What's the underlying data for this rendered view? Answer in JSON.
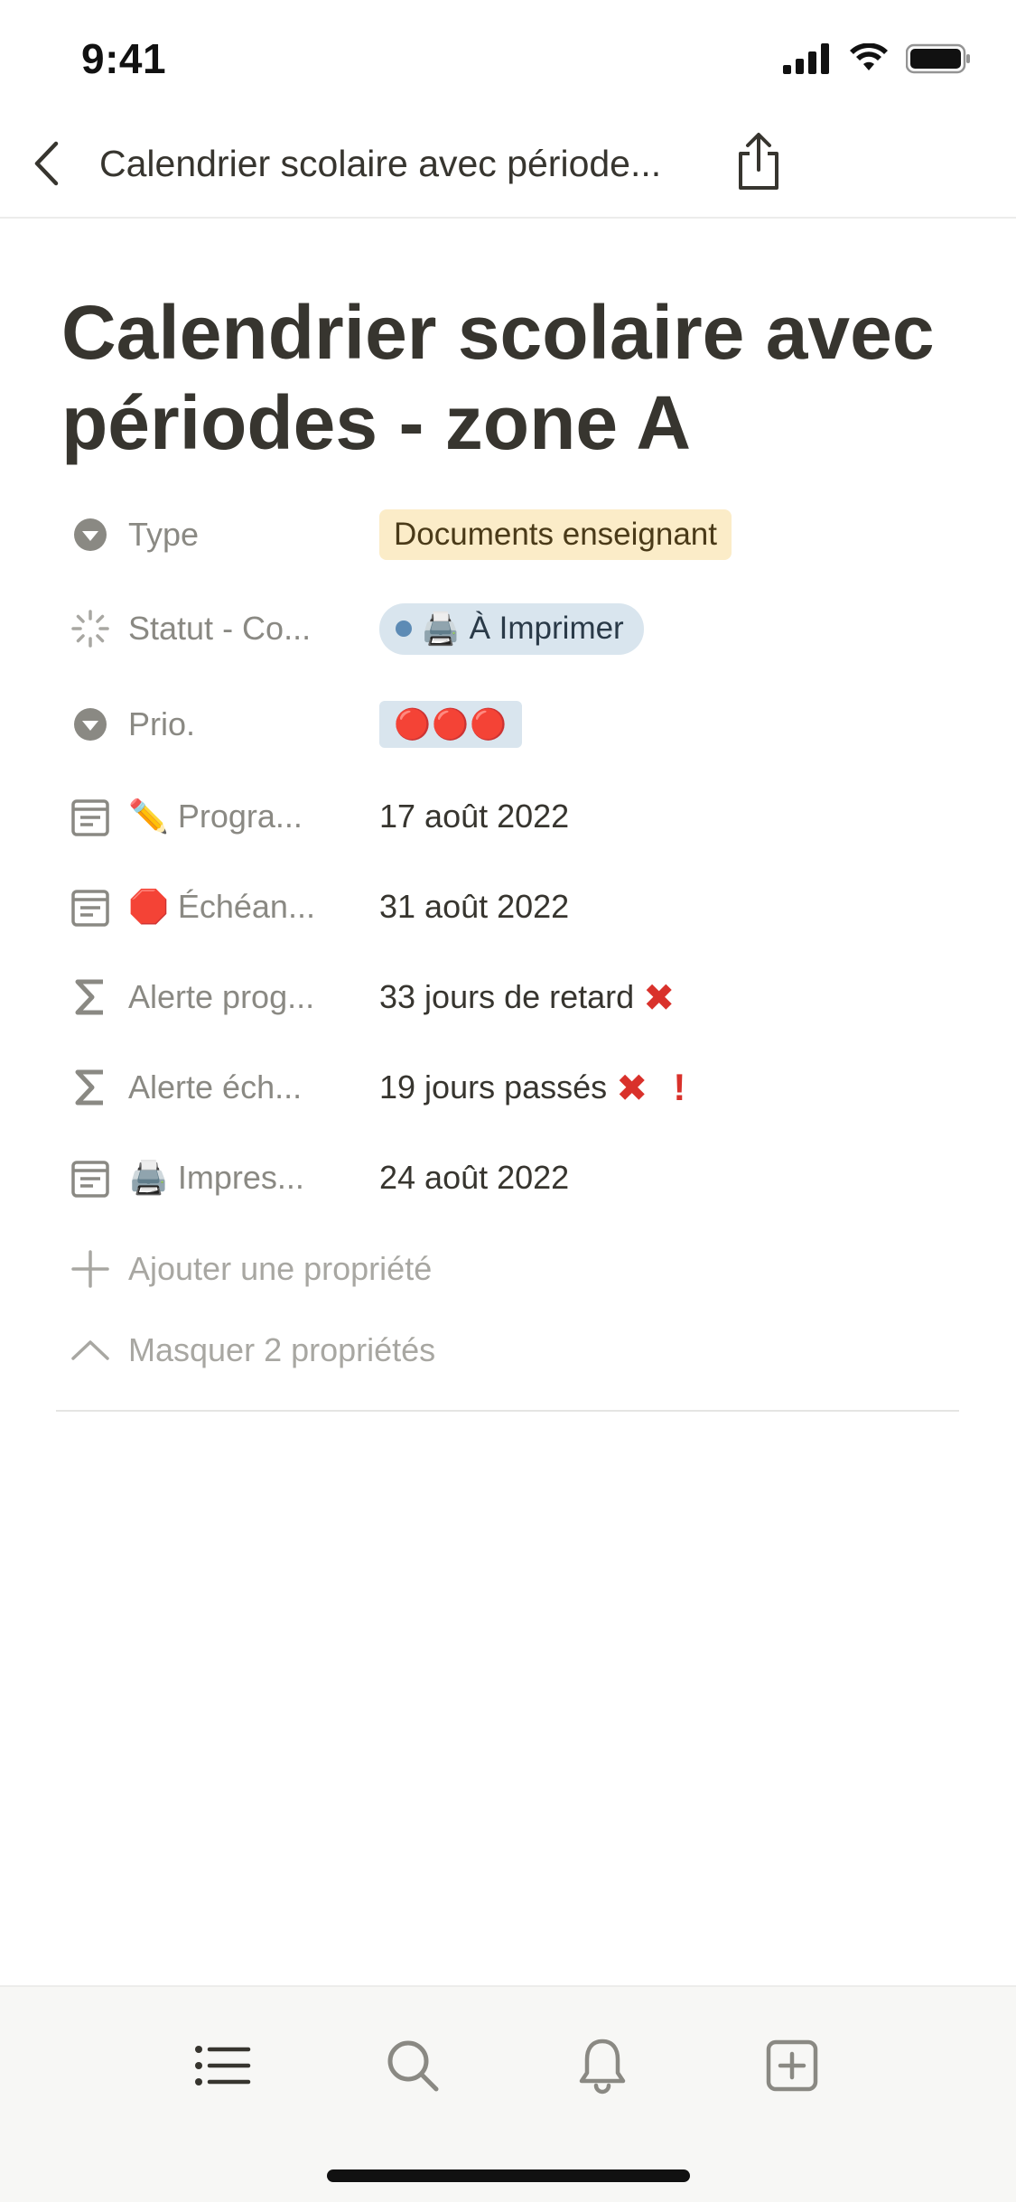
{
  "status_bar": {
    "time": "9:41"
  },
  "nav": {
    "title": "Calendrier scolaire avec période..."
  },
  "page": {
    "title": "Calendrier scolaire avec périodes - zone A"
  },
  "properties": [
    {
      "icon": "dropdown-icon",
      "emoji": "",
      "name": "Type",
      "value": "Documents enseignant"
    },
    {
      "icon": "status-icon",
      "emoji": "",
      "name": "Statut - Co...",
      "value_emoji": "🖨️",
      "value": "À Imprimer"
    },
    {
      "icon": "dropdown-icon",
      "emoji": "",
      "name": "Prio.",
      "value": "🔴🔴🔴"
    },
    {
      "icon": "calendar-icon",
      "emoji": "✏️",
      "name": "Progra...",
      "value": "17 août 2022"
    },
    {
      "icon": "calendar-icon",
      "emoji": "🛑",
      "name": "Échéan...",
      "value": "31 août 2022"
    },
    {
      "icon": "formula-icon",
      "emoji": "",
      "name": "Alerte prog...",
      "value": "33 jours de retard",
      "value_suffix": "✖"
    },
    {
      "icon": "formula-icon",
      "emoji": "",
      "name": "Alerte éch...",
      "value": "19 jours passés",
      "value_suffix": "✖",
      "value_suffix2": "!"
    },
    {
      "icon": "calendar-icon",
      "emoji": "🖨️",
      "name": "Impres...",
      "value": "24 août 2022"
    }
  ],
  "actions": {
    "add_property": "Ajouter une propriété",
    "hide_properties": "Masquer 2 propriétés"
  },
  "tab_bar": [
    "list-icon",
    "search-icon",
    "bell-icon",
    "add-page-icon"
  ],
  "colors": {
    "accent_red": "#d9312b",
    "tag_yellow": "#fbecc8",
    "tag_blue": "#d9e5ee",
    "status_dot": "#5d8bb5"
  }
}
